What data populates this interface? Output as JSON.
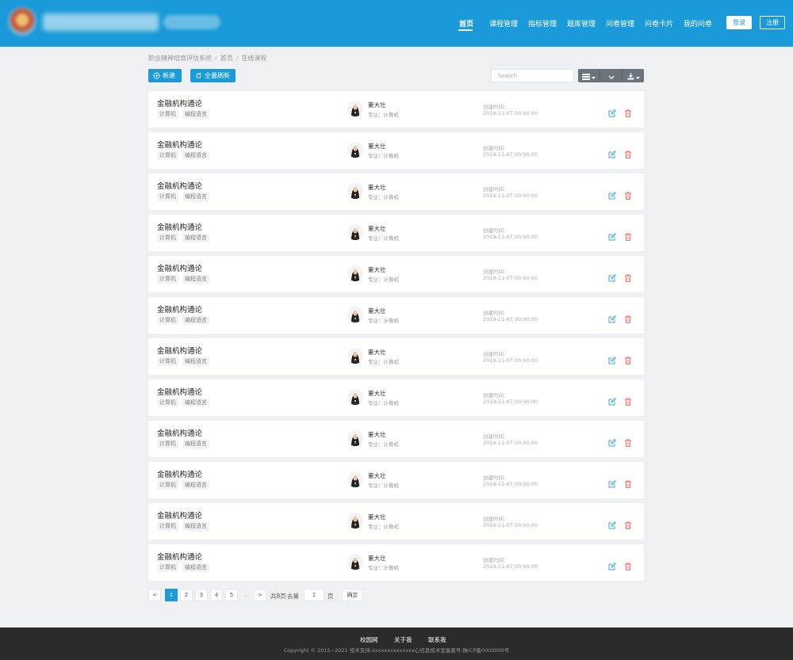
{
  "header": {
    "nav": [
      {
        "label": "首页",
        "active": true
      },
      {
        "label": "课程管理",
        "active": false
      },
      {
        "label": "指标管理",
        "active": false
      },
      {
        "label": "题库管理",
        "active": false
      },
      {
        "label": "问卷管理",
        "active": false
      },
      {
        "label": "问卷卡片",
        "active": false
      },
      {
        "label": "我的问卷",
        "active": false
      }
    ],
    "login_label": "登录",
    "register_label": "注册"
  },
  "breadcrumb": [
    "职业精神培育评估系统",
    "首页",
    "在线课程"
  ],
  "toolbar": {
    "new_label": "新建",
    "refresh_label": "全量刷新",
    "search_placeholder": "Search"
  },
  "colors": {
    "primary": "#1a9ad8",
    "edit": "#39a8dc",
    "delete": "#f06f6f",
    "footer": "#2b2b2b"
  },
  "cards": [
    {
      "title": "金融机构通论",
      "tags": [
        "计算机",
        "编程语言"
      ],
      "teacher": "董大壮",
      "major": "专业：计算机",
      "created_label": "创建时间:",
      "created": "2019-11-07 00:00:00"
    },
    {
      "title": "金融机构通论",
      "tags": [
        "计算机",
        "编程语言"
      ],
      "teacher": "董大壮",
      "major": "专业：计算机",
      "created_label": "创建时间:",
      "created": "2019-11-07 00:00:00"
    },
    {
      "title": "金融机构通论",
      "tags": [
        "计算机",
        "编程语言"
      ],
      "teacher": "董大壮",
      "major": "专业：计算机",
      "created_label": "创建时间:",
      "created": "2019-11-07 00:00:00"
    },
    {
      "title": "金融机构通论",
      "tags": [
        "计算机",
        "编程语言"
      ],
      "teacher": "董大壮",
      "major": "专业：计算机",
      "created_label": "创建时间:",
      "created": "2019-11-07 00:00:00"
    },
    {
      "title": "金融机构通论",
      "tags": [
        "计算机",
        "编程语言"
      ],
      "teacher": "董大壮",
      "major": "专业：计算机",
      "created_label": "创建时间:",
      "created": "2019-11-07 00:00:00"
    },
    {
      "title": "金融机构通论",
      "tags": [
        "计算机",
        "编程语言"
      ],
      "teacher": "董大壮",
      "major": "专业：计算机",
      "created_label": "创建时间:",
      "created": "2019-11-07 00:00:00"
    },
    {
      "title": "金融机构通论",
      "tags": [
        "计算机",
        "编程语言"
      ],
      "teacher": "董大壮",
      "major": "专业：计算机",
      "created_label": "创建时间:",
      "created": "2019-11-07 00:00:00"
    },
    {
      "title": "金融机构通论",
      "tags": [
        "计算机",
        "编程语言"
      ],
      "teacher": "董大壮",
      "major": "专业：计算机",
      "created_label": "创建时间:",
      "created": "2019-11-07 00:00:00"
    },
    {
      "title": "金融机构通论",
      "tags": [
        "计算机",
        "编程语言"
      ],
      "teacher": "董大壮",
      "major": "专业：计算机",
      "created_label": "创建时间:",
      "created": "2019-11-07 00:00:00"
    },
    {
      "title": "金融机构通论",
      "tags": [
        "计算机",
        "编程语言"
      ],
      "teacher": "董大壮",
      "major": "专业：计算机",
      "created_label": "创建时间:",
      "created": "2019-11-07 00:00:00"
    },
    {
      "title": "金融机构通论",
      "tags": [
        "计算机",
        "编程语言"
      ],
      "teacher": "董大壮",
      "major": "专业：计算机",
      "created_label": "创建时间:",
      "created": "2019-11-07 00:00:00"
    },
    {
      "title": "金融机构通论",
      "tags": [
        "计算机",
        "编程语言"
      ],
      "teacher": "董大壮",
      "major": "专业：计算机",
      "created_label": "创建时间:",
      "created": "2019-11-07 00:00:00"
    }
  ],
  "pagination": {
    "prev": "<",
    "pages": [
      "1",
      "2",
      "3",
      "4",
      "5"
    ],
    "current": "1",
    "ellipsis": "...",
    "next": ">",
    "total_text": "共8页",
    "goto_text": "去第",
    "goto_value": "1",
    "page_unit": "页",
    "confirm_label": "确定"
  },
  "footer": {
    "links": [
      "校园网",
      "关于我",
      "联系我"
    ],
    "copyright": "Copyright © 2015~2021 技术支持:xxxxxxxxxxxxxx心信息技术室备案号:陕ICP备0000000号"
  }
}
